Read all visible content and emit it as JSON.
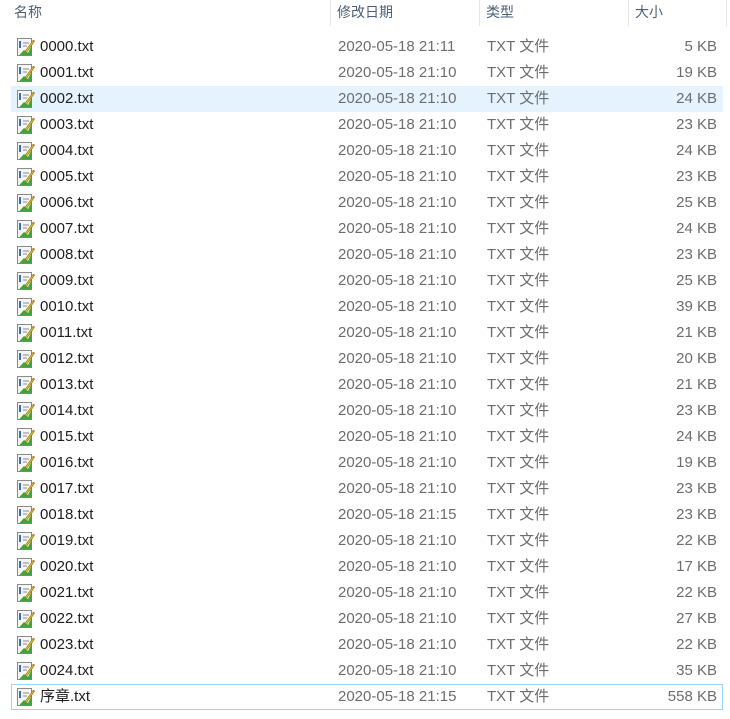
{
  "header": {
    "name": "名称",
    "date": "修改日期",
    "type": "类型",
    "size": "大小"
  },
  "icon": "notepad-txt-file-icon",
  "files": [
    {
      "name": "0000.txt",
      "date": "2020-05-18 21:11",
      "type": "TXT 文件",
      "size": "5 KB"
    },
    {
      "name": "0001.txt",
      "date": "2020-05-18 21:10",
      "type": "TXT 文件",
      "size": "19 KB"
    },
    {
      "name": "0002.txt",
      "date": "2020-05-18 21:10",
      "type": "TXT 文件",
      "size": "24 KB",
      "selected": true
    },
    {
      "name": "0003.txt",
      "date": "2020-05-18 21:10",
      "type": "TXT 文件",
      "size": "23 KB"
    },
    {
      "name": "0004.txt",
      "date": "2020-05-18 21:10",
      "type": "TXT 文件",
      "size": "24 KB"
    },
    {
      "name": "0005.txt",
      "date": "2020-05-18 21:10",
      "type": "TXT 文件",
      "size": "23 KB"
    },
    {
      "name": "0006.txt",
      "date": "2020-05-18 21:10",
      "type": "TXT 文件",
      "size": "25 KB"
    },
    {
      "name": "0007.txt",
      "date": "2020-05-18 21:10",
      "type": "TXT 文件",
      "size": "24 KB"
    },
    {
      "name": "0008.txt",
      "date": "2020-05-18 21:10",
      "type": "TXT 文件",
      "size": "23 KB"
    },
    {
      "name": "0009.txt",
      "date": "2020-05-18 21:10",
      "type": "TXT 文件",
      "size": "25 KB"
    },
    {
      "name": "0010.txt",
      "date": "2020-05-18 21:10",
      "type": "TXT 文件",
      "size": "39 KB"
    },
    {
      "name": "0011.txt",
      "date": "2020-05-18 21:10",
      "type": "TXT 文件",
      "size": "21 KB"
    },
    {
      "name": "0012.txt",
      "date": "2020-05-18 21:10",
      "type": "TXT 文件",
      "size": "20 KB"
    },
    {
      "name": "0013.txt",
      "date": "2020-05-18 21:10",
      "type": "TXT 文件",
      "size": "21 KB"
    },
    {
      "name": "0014.txt",
      "date": "2020-05-18 21:10",
      "type": "TXT 文件",
      "size": "23 KB"
    },
    {
      "name": "0015.txt",
      "date": "2020-05-18 21:10",
      "type": "TXT 文件",
      "size": "24 KB"
    },
    {
      "name": "0016.txt",
      "date": "2020-05-18 21:10",
      "type": "TXT 文件",
      "size": "19 KB"
    },
    {
      "name": "0017.txt",
      "date": "2020-05-18 21:10",
      "type": "TXT 文件",
      "size": "23 KB"
    },
    {
      "name": "0018.txt",
      "date": "2020-05-18 21:15",
      "type": "TXT 文件",
      "size": "23 KB"
    },
    {
      "name": "0019.txt",
      "date": "2020-05-18 21:10",
      "type": "TXT 文件",
      "size": "22 KB"
    },
    {
      "name": "0020.txt",
      "date": "2020-05-18 21:10",
      "type": "TXT 文件",
      "size": "17 KB"
    },
    {
      "name": "0021.txt",
      "date": "2020-05-18 21:10",
      "type": "TXT 文件",
      "size": "22 KB"
    },
    {
      "name": "0022.txt",
      "date": "2020-05-18 21:10",
      "type": "TXT 文件",
      "size": "27 KB"
    },
    {
      "name": "0023.txt",
      "date": "2020-05-18 21:10",
      "type": "TXT 文件",
      "size": "22 KB"
    },
    {
      "name": "0024.txt",
      "date": "2020-05-18 21:10",
      "type": "TXT 文件",
      "size": "35 KB"
    },
    {
      "name": "序章.txt",
      "date": "2020-05-18 21:15",
      "type": "TXT 文件",
      "size": "558 KB",
      "focused": true
    }
  ]
}
